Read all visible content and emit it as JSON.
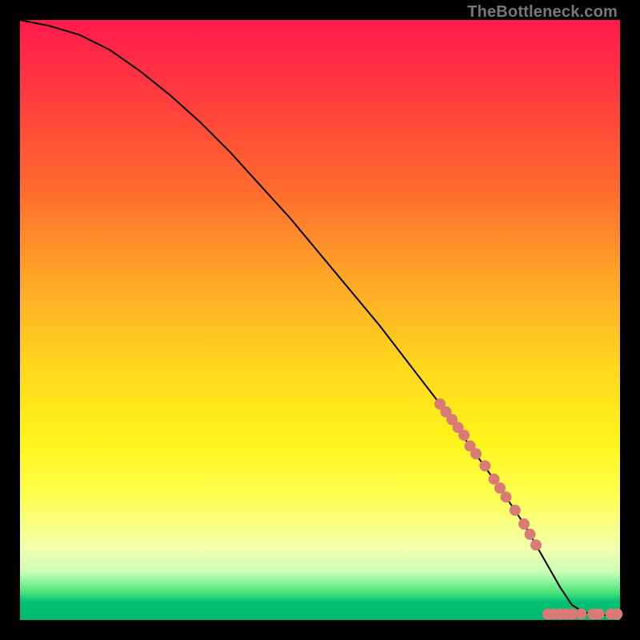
{
  "attribution": "TheBottleneck.com",
  "chart_data": {
    "type": "line",
    "title": "",
    "xlabel": "",
    "ylabel": "",
    "xlim": [
      0,
      100
    ],
    "ylim": [
      0,
      100
    ],
    "grid": false,
    "legend": false,
    "series": [
      {
        "name": "curve",
        "type": "line",
        "x": [
          0,
          5,
          10,
          15,
          20,
          25,
          30,
          35,
          40,
          45,
          50,
          55,
          60,
          65,
          70,
          75,
          80,
          82,
          84,
          86,
          88,
          90,
          92,
          94,
          96,
          98,
          100
        ],
        "y": [
          100,
          99,
          97.5,
          95,
          91.5,
          87.5,
          83,
          78,
          72.5,
          67,
          61,
          55,
          49,
          42.5,
          36,
          29,
          22,
          19,
          16,
          12.5,
          9,
          5.5,
          2.5,
          1.3,
          0.9,
          0.8,
          0.8
        ]
      },
      {
        "name": "markers-diagonal",
        "type": "scatter",
        "x": [
          70.0,
          71.0,
          72.0,
          73.0,
          74.0,
          75.0,
          76.0,
          77.5,
          79.0,
          80.0,
          81.0,
          82.5,
          84.0,
          85.0,
          86.0
        ],
        "y": [
          36.0,
          34.7,
          33.4,
          32.1,
          30.8,
          29.0,
          27.7,
          25.7,
          23.5,
          22.0,
          20.5,
          18.3,
          16.0,
          14.3,
          12.5
        ]
      },
      {
        "name": "markers-bottom",
        "type": "scatter",
        "x": [
          88.0,
          89.0,
          90.0,
          91.0,
          92.0,
          93.5,
          95.5,
          96.5,
          98.5,
          99.5
        ],
        "y": [
          1.0,
          1.0,
          1.0,
          1.0,
          1.0,
          1.0,
          1.0,
          1.0,
          1.0,
          1.0
        ]
      }
    ],
    "marker_color": "#d97a76",
    "line_color": "#000000"
  }
}
